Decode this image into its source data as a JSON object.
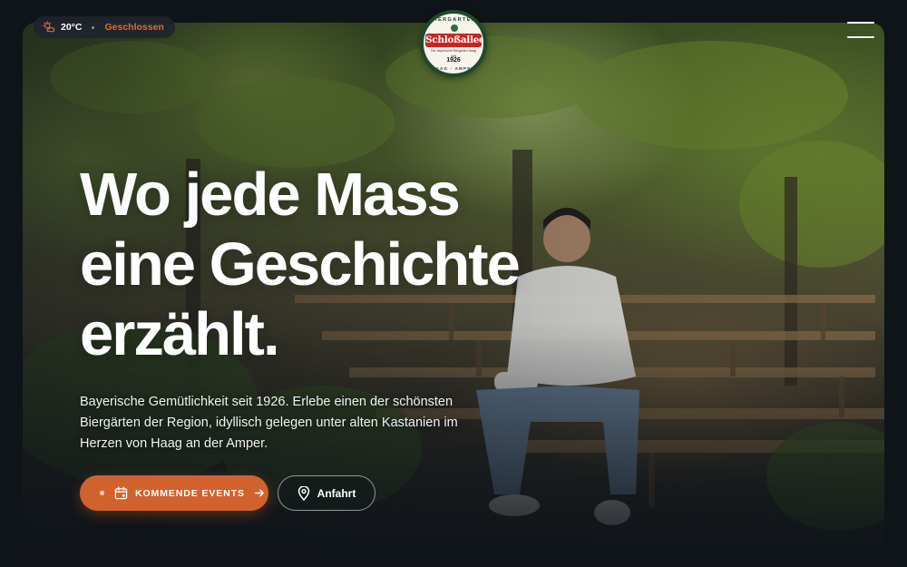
{
  "status": {
    "temperature": "20°C",
    "opening_state": "Geschlossen",
    "weather_icon": "sun-cloud-icon",
    "closed_color": "#e0673a"
  },
  "logo": {
    "arc_top": "BIERGARTEN",
    "wordmark": "Schloßallee",
    "tagline": "Der bayerische Biergarten Haag",
    "since": "seit",
    "year": "1926",
    "arc_bottom": "HAAG · AMPER"
  },
  "menu": {
    "icon": "hamburger-menu-icon"
  },
  "hero": {
    "headline": [
      "Wo jede Mass",
      "eine Geschichte",
      "erzählt."
    ],
    "lead": "Bayerische Gemütlichkeit seit 1926. Erlebe einen der schönsten Biergärten der Region, idyllisch gelegen unter alten Kastanien im Herzen von Haag an der Amper."
  },
  "actions": {
    "events_label": "KOMMENDE EVENTS",
    "events_icon": "calendar-icon",
    "route_label": "Anfahrt",
    "route_icon": "map-pin-icon",
    "accent_color": "#d2622d"
  }
}
